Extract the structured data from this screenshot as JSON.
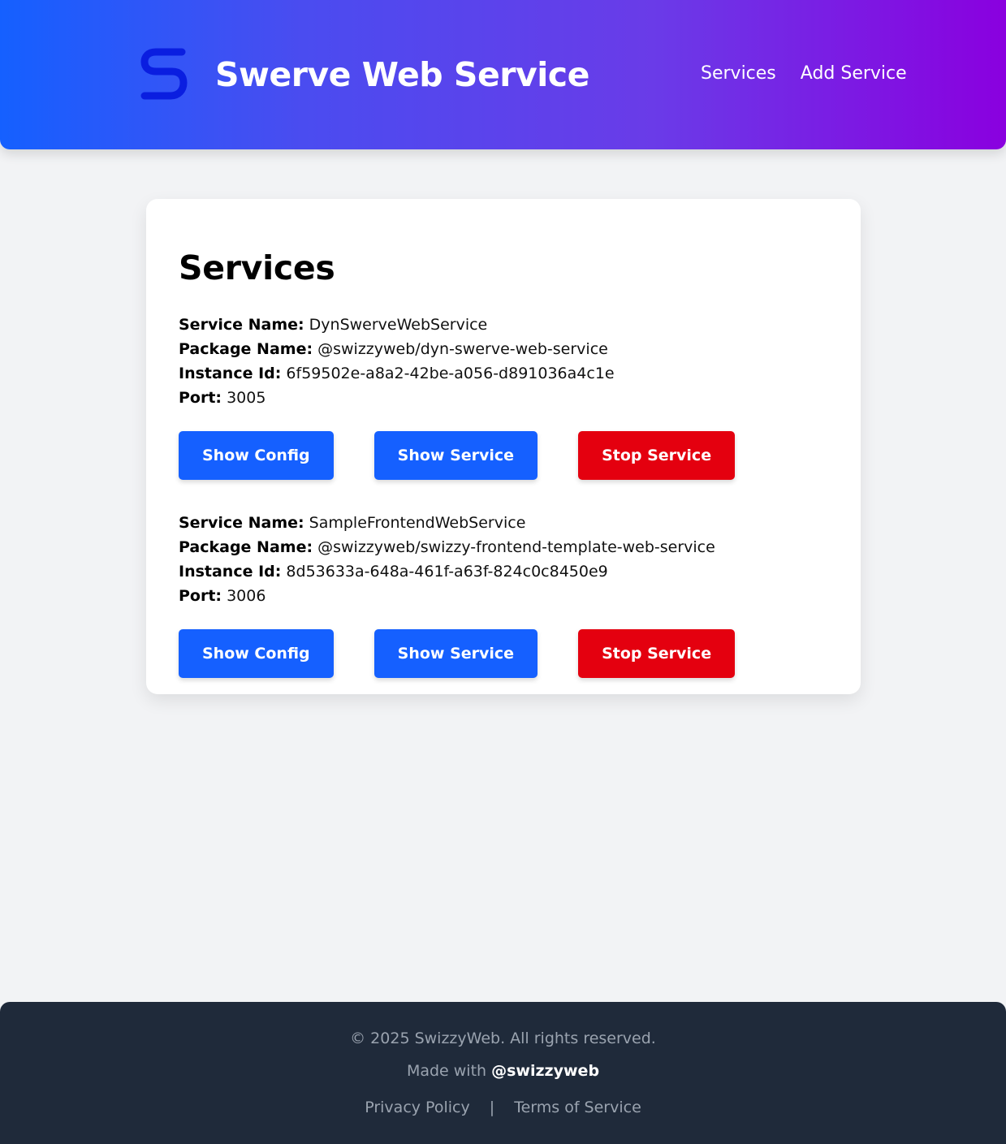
{
  "header": {
    "logo_icon": "s-logo-icon",
    "logo_color": "#0a1ee0",
    "title": "Swerve Web Service",
    "nav": [
      {
        "label": "Services"
      },
      {
        "label": "Add Service"
      }
    ]
  },
  "main": {
    "title": "Services",
    "field_labels": {
      "service_name": "Service Name:",
      "package_name": "Package Name:",
      "instance_id": "Instance Id:",
      "port": "Port:"
    },
    "services": [
      {
        "service_name": "DynSwerveWebService",
        "package_name": "@swizzyweb/dyn-swerve-web-service",
        "instance_id": "6f59502e-a8a2-42be-a056-d891036a4c1e",
        "port": "3005",
        "show_config_label": "Show Config",
        "show_service_label": "Show Service",
        "stop_service_label": "Stop Service"
      },
      {
        "service_name": "SampleFrontendWebService",
        "package_name": "@swizzyweb/swizzy-frontend-template-web-service",
        "instance_id": "8d53633a-648a-461f-a63f-824c0c8450e9",
        "port": "3006",
        "show_config_label": "Show Config",
        "show_service_label": "Show Service",
        "stop_service_label": "Stop Service"
      }
    ]
  },
  "footer": {
    "copyright": "© 2025 SwizzyWeb. All rights reserved.",
    "made_with_prefix": "Made with",
    "made_with_handle": "@swizzyweb",
    "privacy_label": "Privacy Policy",
    "separator": "|",
    "terms_label": "Terms of Service"
  },
  "colors": {
    "primary_blue": "#1560ff",
    "danger_red": "#e4000f",
    "header_gradient_start": "#1560ff",
    "header_gradient_end": "#8a00df",
    "footer_bg": "#1f2a3a"
  }
}
